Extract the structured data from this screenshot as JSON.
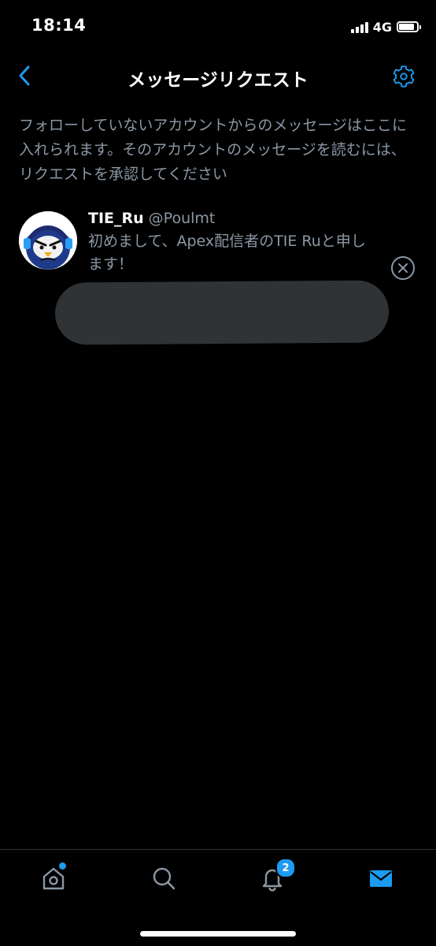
{
  "status_bar": {
    "time": "18:14",
    "network": "4G",
    "signal_bars": 4,
    "battery_level": 0.85
  },
  "header": {
    "title": "メッセージリクエスト",
    "back_icon": "chevron-left-icon",
    "settings_icon": "gear-icon"
  },
  "description": {
    "text": "フォローしていないアカウントからのメッセージはここに入れられます。そのアカウントのメッセージを読むには、リクエストを承認してください"
  },
  "requests": [
    {
      "name": "TIE_Ru",
      "handle": "@Poulmt",
      "preview": "初めまして、Apex配信者のTIE Ruと申します！",
      "avatar_icon": "penguin-headset-avatar"
    }
  ],
  "tab_bar": {
    "tabs": [
      {
        "name": "home",
        "icon": "home-icon",
        "has_dot": true
      },
      {
        "name": "search",
        "icon": "search-icon"
      },
      {
        "name": "notifications",
        "icon": "bell-icon",
        "badge": "2"
      },
      {
        "name": "messages",
        "icon": "mail-icon",
        "active": true
      }
    ]
  },
  "colors": {
    "background": "#000000",
    "accent": "#1d9bf0",
    "secondary_text": "#8b98a5",
    "primary_text": "#ffffff",
    "redaction": "#2f3336"
  }
}
